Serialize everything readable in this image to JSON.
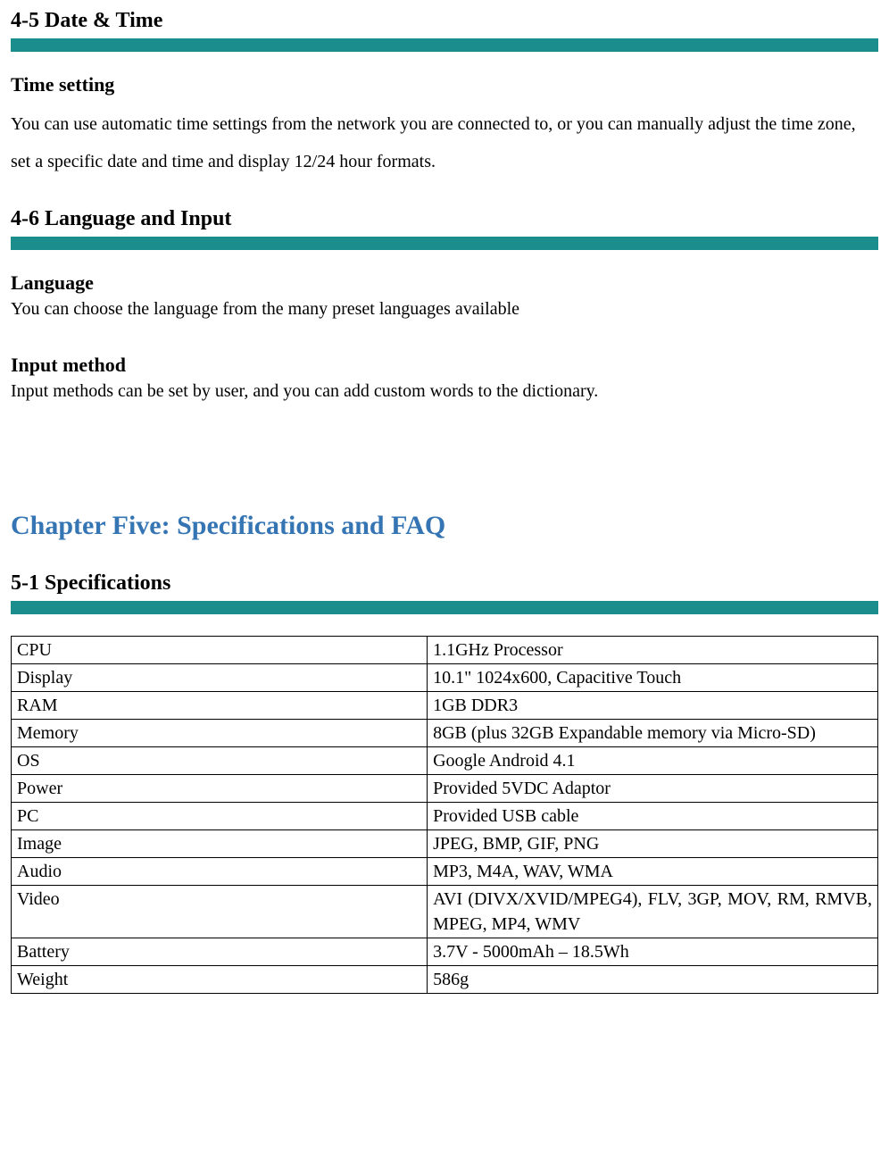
{
  "sections": {
    "s45": {
      "title": "4-5 Date & Time",
      "subheading": "Time setting",
      "text": "You can use automatic time settings from the network you are connected to, or you can manually adjust the time zone, set a specific date and time and display 12/24 hour formats."
    },
    "s46": {
      "title": "4-6 Language and Input",
      "lang_heading": "Language",
      "lang_text": "You can choose the language from the many preset languages available",
      "input_heading": "Input method",
      "input_text": "Input methods can be set by user, and you can add custom words to the dictionary."
    },
    "chapter": {
      "title": "Chapter Five: Specifications and FAQ"
    },
    "s51": {
      "title": "5-1 Specifications"
    }
  },
  "specs": {
    "rows": [
      {
        "label": "CPU",
        "value": "1.1GHz Processor"
      },
      {
        "label": "Display",
        "value": "10.1\" 1024x600, Capacitive Touch"
      },
      {
        "label": "RAM",
        "value": "1GB DDR3"
      },
      {
        "label": "Memory",
        "value": "8GB (plus 32GB Expandable memory via Micro-SD)"
      },
      {
        "label": "OS",
        "value": "Google Android 4.1"
      },
      {
        "label": "Power",
        "value": "Provided 5VDC Adaptor"
      },
      {
        "label": "PC",
        "value": "Provided USB cable"
      },
      {
        "label": "Image",
        "value": "JPEG, BMP, GIF, PNG"
      },
      {
        "label": "Audio",
        "value": "MP3, M4A, WAV, WMA"
      },
      {
        "label": "Video",
        "value": "AVI (DIVX/XVID/MPEG4), FLV, 3GP, MOV, RM, RMVB, MPEG, MP4, WMV"
      },
      {
        "label": "Battery",
        "value": "3.7V - 5000mAh – 18.5Wh"
      },
      {
        "label": "Weight",
        "value": "586g"
      }
    ]
  }
}
